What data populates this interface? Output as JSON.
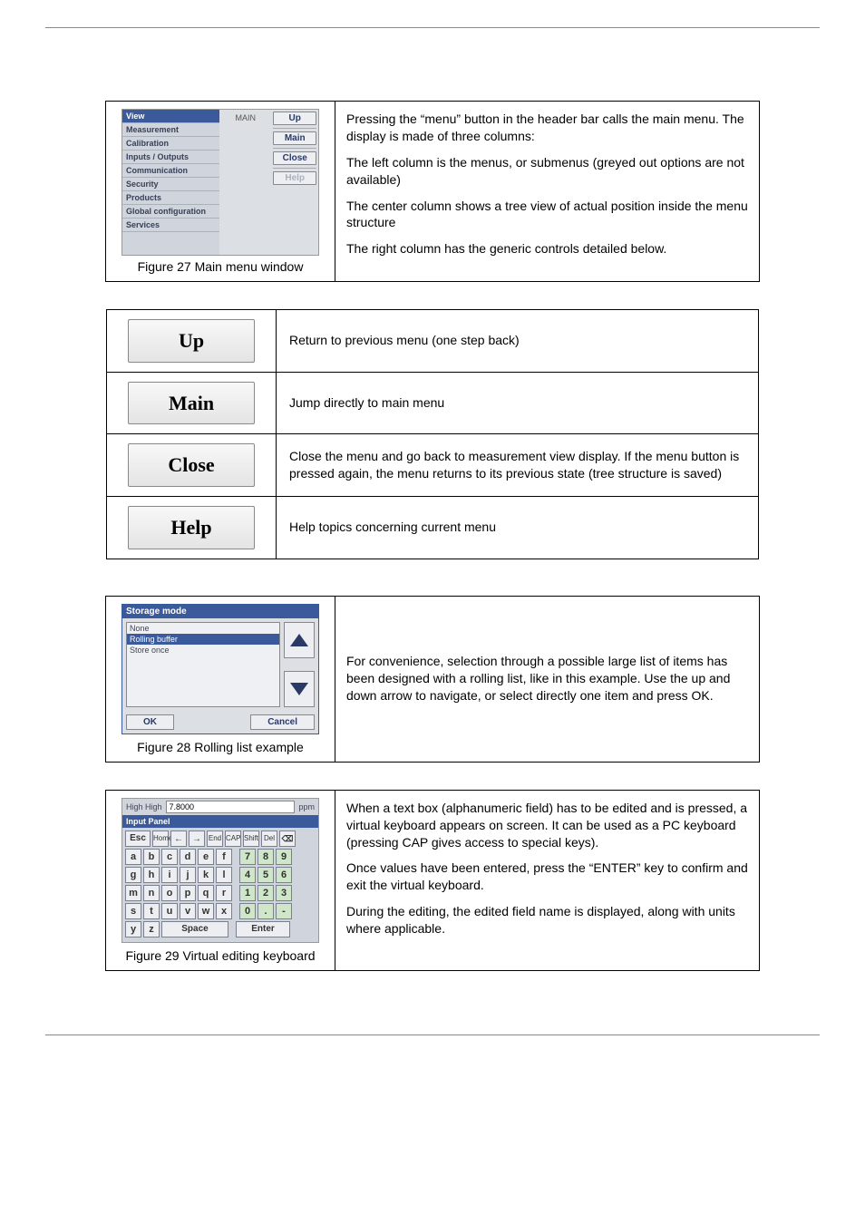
{
  "fig27": {
    "menu_items": [
      "View",
      "Measurement",
      "Calibration",
      "Inputs / Outputs",
      "Communication",
      "Security",
      "Products",
      "Global configuration",
      "Services"
    ],
    "center_label": "MAIN",
    "right_buttons": {
      "up": "Up",
      "main": "Main",
      "close": "Close",
      "help": "Help"
    },
    "caption": "Figure 27  Main menu window",
    "text": {
      "p1": "Pressing the “menu” button in the header bar calls the main menu. The display is made of three columns:",
      "b1": "The left column is the menus, or submenus (greyed out options are not available)",
      "b2": "The center column shows a tree view of actual position inside the menu structure",
      "b3": "The right column has the generic controls detailed below."
    }
  },
  "controls": {
    "rows": [
      {
        "btn": "Up",
        "desc": "Return to previous menu (one step back)"
      },
      {
        "btn": "Main",
        "desc": "Jump directly to main menu"
      },
      {
        "btn": "Close",
        "desc": "Close the menu and go back to measurement view display. If the menu button is pressed again, the menu returns to its previous state (tree structure is saved)"
      },
      {
        "btn": "Help",
        "desc": "Help topics concerning current menu"
      }
    ]
  },
  "fig28": {
    "title": "Storage mode",
    "list": [
      "None",
      "Rolling buffer",
      "Store once"
    ],
    "ok": "OK",
    "cancel": "Cancel",
    "caption": "Figure 28  Rolling list example",
    "text": "For convenience, selection through a possible large list of items has been designed with a rolling list, like in this example. Use the up and down arrow to navigate, or select directly one item and press OK."
  },
  "fig29": {
    "header_label": "High High",
    "field_value": "7.8000",
    "unit": "ppm",
    "panel_label": "Input Panel",
    "keys": {
      "esc": "Esc",
      "home": "Home",
      "end": "End",
      "cap": "CAP",
      "shift": "Shift",
      "del": "Del",
      "space": "Space",
      "enter": "Enter",
      "row2": [
        "a",
        "b",
        "c",
        "d",
        "e",
        "f"
      ],
      "row3": [
        "g",
        "h",
        "i",
        "j",
        "k",
        "l"
      ],
      "row4": [
        "m",
        "n",
        "o",
        "p",
        "q",
        "r"
      ],
      "row5": [
        "s",
        "t",
        "u",
        "v",
        "w",
        "x"
      ],
      "row6": [
        "y",
        "z"
      ],
      "num2": [
        "7",
        "8",
        "9"
      ],
      "num3": [
        "4",
        "5",
        "6"
      ],
      "num4": [
        "1",
        "2",
        "3"
      ],
      "num5": [
        "0",
        ".",
        "-"
      ]
    },
    "caption": "Figure 29  Virtual editing keyboard",
    "text": {
      "p1": "When a text box (alphanumeric field) has to be edited and is pressed, a virtual keyboard appears on screen. It can be used as a PC keyboard (pressing CAP gives access to special keys).",
      "p2": "Once values have been entered, press the “ENTER” key to confirm and exit the virtual keyboard.",
      "p3": "During the editing, the edited field name is displayed, along with units where applicable."
    }
  }
}
